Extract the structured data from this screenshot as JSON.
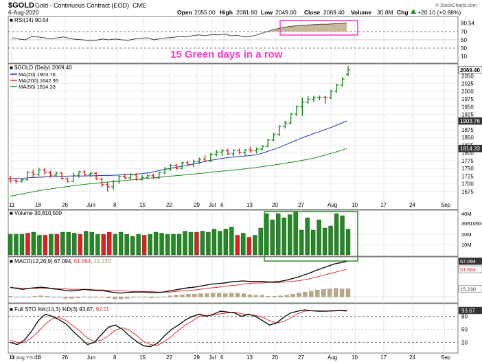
{
  "header": {
    "symbol": "$GOLD",
    "name": "Gold - Continuous Contract (EOD)",
    "exchange": "CME",
    "date": "6-Aug-2020",
    "open_label": "Open",
    "open": "2055.00",
    "high_label": "High",
    "high": "2081.80",
    "low_label": "Low",
    "low": "2049.00",
    "close_label": "Close",
    "close": "2069.40",
    "volume_label": "Volume",
    "volume": "30.8M",
    "chg_label": "Chg",
    "chg": "+20.10 (+0.98%)",
    "chg_icon": "up-triangle",
    "watermark": "© StockCharts.com"
  },
  "annotation": {
    "text": "15 Green days in a row",
    "color": "#ff33cc"
  },
  "colors": {
    "up": "#1e8c1e",
    "down": "#e02020",
    "ma20": "#2233aa",
    "ma200": "#e03030",
    "ma50": "#1e8c1e",
    "highlight_pink": "#ff33cc",
    "highlight_green": "#2a8a2a"
  },
  "chart_data": [
    {
      "type": "line",
      "panel": "rsi",
      "legend": "RSI(14) 90.54",
      "ylim": [
        0,
        100
      ],
      "ticks": [
        "90.54",
        "70",
        "50",
        "30",
        "10"
      ],
      "guide_levels": [
        70,
        30
      ],
      "values": [
        55,
        52,
        50,
        58,
        57,
        55,
        52,
        55,
        57,
        53,
        51,
        50,
        48,
        49,
        52,
        50,
        52,
        50,
        49,
        52,
        54,
        55,
        50,
        53,
        55,
        56,
        58,
        57,
        60,
        62,
        60,
        63,
        62,
        64,
        60,
        61,
        57,
        58,
        62,
        67,
        72,
        76,
        80,
        82,
        84,
        85,
        86,
        87,
        88,
        88,
        89,
        90,
        90.54
      ]
    },
    {
      "type": "candlestick",
      "panel": "price",
      "legend": "$GOLD (Daily) 2069.40",
      "close_label": "2069.40",
      "ylim": [
        1650,
        2080
      ],
      "y_ticks": [
        2050,
        2025,
        2000,
        1975,
        1950,
        1925,
        1900,
        1875,
        1850,
        1825,
        1800,
        1775,
        1750,
        1725,
        1700,
        1675
      ],
      "series": [
        {
          "name": "MA(20) 1903.76",
          "color": "#2233aa",
          "values": [
            1718,
            1717,
            1718,
            1720,
            1721,
            1722,
            1723,
            1723,
            1724,
            1725,
            1725,
            1725,
            1726,
            1726,
            1727,
            1727,
            1728,
            1729,
            1730,
            1731,
            1733,
            1736,
            1740,
            1745,
            1749,
            1753,
            1757,
            1761,
            1765,
            1770,
            1775,
            1778,
            1782,
            1785,
            1787,
            1789,
            1791,
            1793,
            1798,
            1805,
            1812,
            1820,
            1829,
            1838,
            1847,
            1855,
            1863,
            1870,
            1878,
            1886,
            1895,
            1903.76
          ]
        },
        {
          "name": "MA(200) 1642.95",
          "color": "#e03030",
          "values": []
        },
        {
          "name": "MA(50) 1814.33",
          "color": "#1e8c1e",
          "values": [
            1660,
            1664,
            1668,
            1672,
            1676,
            1680,
            1683,
            1686,
            1689,
            1692,
            1695,
            1697,
            1700,
            1702,
            1704,
            1706,
            1708,
            1710,
            1712,
            1714,
            1716,
            1718,
            1720,
            1722,
            1724,
            1726,
            1728,
            1730,
            1732,
            1734,
            1737,
            1739,
            1741,
            1743,
            1745,
            1747,
            1750,
            1752,
            1755,
            1758,
            1761,
            1764,
            1768,
            1771,
            1775,
            1779,
            1783,
            1789,
            1795,
            1801,
            1807,
            1814.33
          ]
        }
      ],
      "right_labels": [
        "2069.40",
        "1903.76",
        "1814.33"
      ],
      "x_ticks": [
        "11",
        "18",
        "26",
        "Jun",
        "8",
        "15",
        "22",
        "29",
        "Jul",
        "6",
        "13",
        "20",
        "27",
        "Aug",
        "10",
        "17",
        "24",
        "Sep"
      ],
      "ohlc": [
        [
          1716,
          1726,
          1704,
          1710
        ],
        [
          1710,
          1717,
          1702,
          1708
        ],
        [
          1708,
          1716,
          1704,
          1713
        ],
        [
          1713,
          1741,
          1710,
          1737
        ],
        [
          1737,
          1746,
          1720,
          1730
        ],
        [
          1730,
          1752,
          1726,
          1745
        ],
        [
          1745,
          1751,
          1730,
          1736
        ],
        [
          1736,
          1742,
          1720,
          1728
        ],
        [
          1728,
          1740,
          1724,
          1735
        ],
        [
          1735,
          1738,
          1714,
          1717
        ],
        [
          1717,
          1720,
          1704,
          1708
        ],
        [
          1708,
          1736,
          1705,
          1727
        ],
        [
          1727,
          1742,
          1720,
          1739
        ],
        [
          1739,
          1743,
          1725,
          1730
        ],
        [
          1730,
          1738,
          1722,
          1734
        ],
        [
          1734,
          1739,
          1713,
          1715
        ],
        [
          1715,
          1720,
          1690,
          1697
        ],
        [
          1697,
          1705,
          1675,
          1690
        ],
        [
          1690,
          1712,
          1680,
          1708
        ],
        [
          1708,
          1730,
          1700,
          1724
        ],
        [
          1724,
          1733,
          1715,
          1719
        ],
        [
          1719,
          1735,
          1714,
          1729
        ],
        [
          1729,
          1735,
          1710,
          1714
        ],
        [
          1714,
          1728,
          1710,
          1720
        ],
        [
          1720,
          1735,
          1715,
          1726
        ],
        [
          1726,
          1733,
          1716,
          1719
        ],
        [
          1719,
          1740,
          1716,
          1736
        ],
        [
          1736,
          1755,
          1730,
          1748
        ],
        [
          1748,
          1764,
          1742,
          1760
        ],
        [
          1760,
          1765,
          1745,
          1750
        ],
        [
          1750,
          1772,
          1747,
          1768
        ],
        [
          1768,
          1775,
          1758,
          1762
        ],
        [
          1762,
          1778,
          1755,
          1772
        ],
        [
          1772,
          1785,
          1764,
          1780
        ],
        [
          1780,
          1792,
          1770,
          1774
        ],
        [
          1774,
          1800,
          1770,
          1796
        ],
        [
          1796,
          1810,
          1788,
          1803
        ],
        [
          1803,
          1814,
          1790,
          1807
        ],
        [
          1807,
          1814,
          1793,
          1797
        ],
        [
          1797,
          1812,
          1790,
          1808
        ],
        [
          1808,
          1814,
          1796,
          1802
        ],
        [
          1802,
          1812,
          1790,
          1810
        ],
        [
          1810,
          1820,
          1800,
          1807
        ],
        [
          1807,
          1818,
          1798,
          1812
        ],
        [
          1812,
          1825,
          1808,
          1821
        ],
        [
          1821,
          1846,
          1818,
          1842
        ],
        [
          1842,
          1865,
          1838,
          1860
        ],
        [
          1860,
          1890,
          1855,
          1886
        ],
        [
          1886,
          1904,
          1880,
          1897
        ],
        [
          1897,
          1930,
          1893,
          1926
        ],
        [
          1926,
          1954,
          1920,
          1950
        ],
        [
          1950,
          1980,
          1920,
          1965
        ],
        [
          1965,
          1985,
          1960,
          1974
        ],
        [
          1974,
          1985,
          1965,
          1979
        ],
        [
          1979,
          1986,
          1970,
          1981
        ],
        [
          1981,
          1985,
          1960,
          1979
        ],
        [
          1979,
          2005,
          1975,
          2000
        ],
        [
          2000,
          2025,
          1995,
          2020
        ],
        [
          2020,
          2045,
          2015,
          2040
        ],
        [
          2055,
          2081.8,
          2049,
          2069.4
        ]
      ]
    },
    {
      "type": "bar",
      "panel": "volume",
      "legend": "Volume 30,810,500",
      "ylim": [
        0,
        42
      ],
      "y_ticks": [
        "40M",
        "30810500",
        "20M",
        "10M"
      ],
      "values": [
        20,
        20,
        20,
        21,
        22,
        19,
        19,
        20,
        20,
        22,
        22,
        21,
        20,
        23,
        22,
        20,
        20,
        22,
        20,
        22,
        20,
        18,
        20,
        19,
        20,
        22,
        21,
        20,
        20,
        20,
        23,
        22,
        22,
        23,
        22,
        25,
        23,
        25,
        27,
        19,
        21,
        17,
        19,
        26,
        40,
        34,
        40,
        36,
        39,
        42,
        24,
        36,
        24,
        34,
        26,
        28,
        40,
        38,
        25
      ],
      "colors_up_down": [
        "u",
        "u",
        "u",
        "d",
        "u",
        "u",
        "d",
        "u",
        "d",
        "u",
        "u",
        "u",
        "d",
        "u",
        "u",
        "u",
        "d",
        "d",
        "u",
        "u",
        "u",
        "u",
        "u",
        "d",
        "u",
        "u",
        "u",
        "u",
        "u",
        "u",
        "u",
        "u",
        "d",
        "u",
        "u",
        "u",
        "u",
        "u",
        "u",
        "d",
        "u",
        "d",
        "u",
        "u",
        "u",
        "u",
        "u",
        "u",
        "u",
        "u",
        "u",
        "u",
        "u",
        "u",
        "u",
        "u",
        "u",
        "u",
        "u"
      ]
    },
    {
      "type": "line",
      "panel": "macd",
      "legend_prefix": "MACD(12,26,9)",
      "legend_macd": "67.094",
      "legend_signal": "51.864",
      "legend_hist": "15.230",
      "ylim": [
        -5,
        70
      ],
      "right_labels": [
        "67.094",
        "51.864",
        "15.230"
      ],
      "series": [
        {
          "name": "MACD",
          "values": [
            18,
            16,
            14,
            16,
            17,
            18,
            17,
            15,
            14,
            12,
            11,
            12,
            14,
            13,
            12,
            12,
            10,
            8,
            7,
            8,
            9,
            9,
            9,
            8,
            8,
            9,
            11,
            13,
            15,
            17,
            18,
            20,
            22,
            24,
            25,
            26,
            28,
            29,
            30,
            29,
            29,
            29,
            28,
            28,
            29,
            31,
            34,
            37,
            41,
            45,
            50,
            54,
            58,
            62,
            64,
            67
          ]
        },
        {
          "name": "Signal",
          "values": [
            17,
            17,
            16,
            16,
            16,
            16,
            16,
            16,
            15,
            15,
            14,
            14,
            14,
            14,
            13,
            13,
            12,
            12,
            11,
            11,
            10,
            10,
            10,
            10,
            9,
            9,
            9,
            10,
            11,
            12,
            13,
            14,
            16,
            17,
            18,
            20,
            21,
            22,
            24,
            25,
            26,
            26,
            27,
            27,
            27,
            28,
            29,
            30,
            32,
            34,
            37,
            40,
            43,
            46,
            49,
            51.86
          ]
        }
      ],
      "histogram": [
        1,
        0,
        -1,
        0,
        1,
        2,
        1,
        -1,
        -1,
        -3,
        -3,
        -2,
        0,
        -1,
        -1,
        -1,
        -2,
        -4,
        -4,
        -3,
        -1,
        -1,
        -1,
        -2,
        -1,
        0,
        2,
        3,
        4,
        5,
        5,
        6,
        6,
        7,
        7,
        6,
        7,
        7,
        6,
        4,
        3,
        3,
        1,
        1,
        2,
        3,
        5,
        7,
        9,
        11,
        13,
        14,
        15,
        16,
        15,
        15.23
      ]
    },
    {
      "type": "line",
      "panel": "sto",
      "legend_prefix": "Full STO %K(14,3) %D(3)",
      "legend_k": "93.67",
      "legend_d": "92.11",
      "ylim": [
        0,
        100
      ],
      "right_labels": [
        "93.67",
        "80",
        "50",
        "20"
      ],
      "series": [
        {
          "name": "%K",
          "values": [
            20,
            15,
            25,
            45,
            70,
            85,
            80,
            72,
            62,
            45,
            30,
            15,
            20,
            38,
            55,
            60,
            50,
            35,
            22,
            12,
            10,
            18,
            35,
            50,
            60,
            72,
            80,
            85,
            80,
            85,
            92,
            90,
            88,
            80,
            85,
            80,
            70,
            60,
            65,
            78,
            88,
            92,
            95,
            93,
            92,
            92,
            93,
            94,
            93.67
          ]
        },
        {
          "name": "%D",
          "values": [
            25,
            20,
            20,
            30,
            45,
            62,
            75,
            78,
            70,
            58,
            45,
            30,
            22,
            25,
            35,
            48,
            54,
            48,
            36,
            22,
            15,
            13,
            22,
            34,
            48,
            60,
            70,
            80,
            82,
            83,
            86,
            88,
            90,
            86,
            84,
            82,
            78,
            70,
            65,
            68,
            76,
            86,
            92,
            93,
            93,
            92,
            92,
            93,
            92.11
          ]
        }
      ]
    }
  ],
  "bottom_left_label": "19 Aug Y-5.01"
}
